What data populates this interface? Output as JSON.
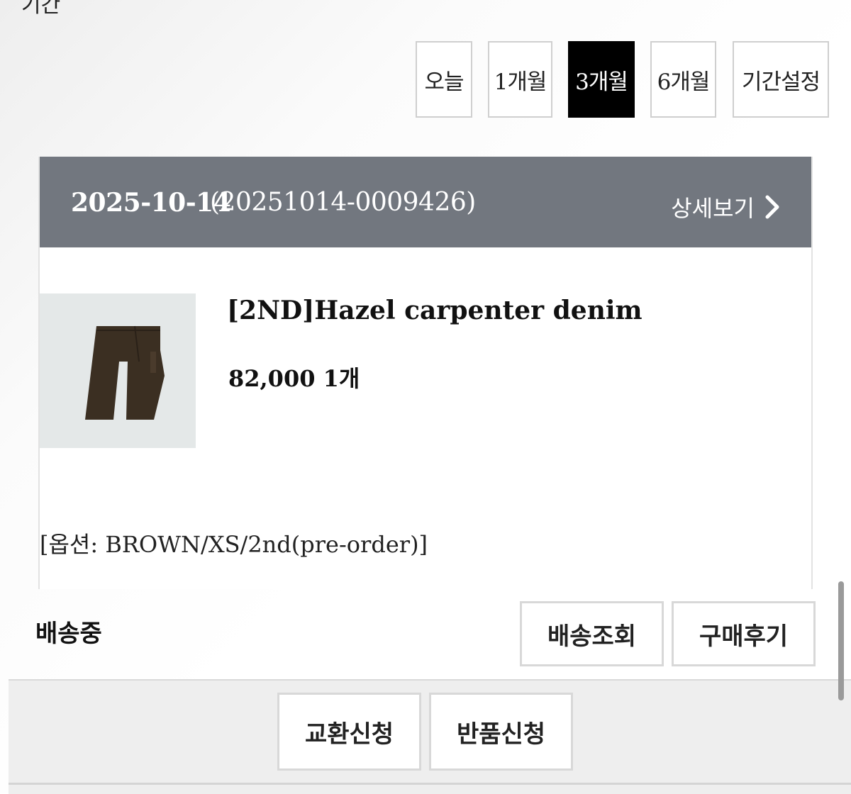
{
  "section": {
    "label": "기간"
  },
  "period_filter": {
    "options": [
      "오늘",
      "1개월",
      "3개월",
      "6개월",
      "기간설정"
    ],
    "selected": "3개월"
  },
  "order": {
    "date": "2025-10-14",
    "order_number": "(20251014-0009426)",
    "detail_label": "상세보기",
    "item": {
      "image_icon": "brown-denim-pants-thumbnail",
      "name": "[2ND]Hazel carpenter denim",
      "price_qty": "82,000 1개",
      "option": "[옵션: BROWN/XS/2nd(pre-order)]"
    },
    "status": "배송중",
    "actions": {
      "track_label": "배송조회",
      "review_label": "구매후기"
    }
  },
  "bottom_actions": {
    "exchange_label": "교환신청",
    "return_label": "반품신청"
  },
  "colors": {
    "header_bg": "#72777f",
    "active_bg": "#000000",
    "product_brown": "#3b2f22"
  }
}
